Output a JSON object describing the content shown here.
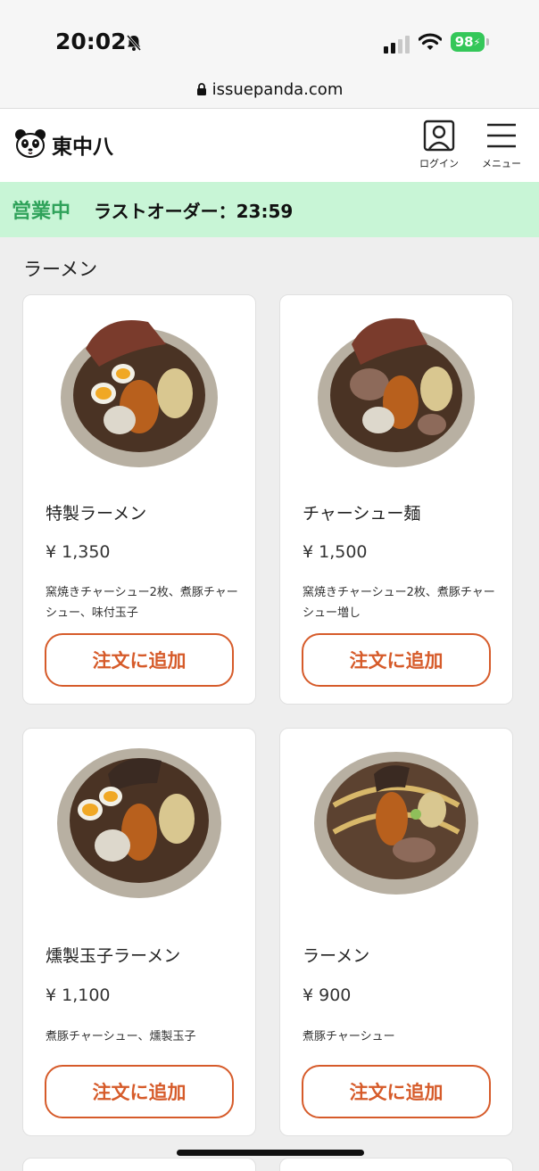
{
  "status_bar": {
    "time": "20:02",
    "battery": "98"
  },
  "browser": {
    "url": "issuepanda.com"
  },
  "header": {
    "logo_text": "東中八",
    "login_label": "ログイン",
    "menu_label": "メニュー"
  },
  "store_status": {
    "open_label": "営業中",
    "last_order": "ラストオーダー：23:59",
    "color": "#2fa25a",
    "background": "#c8f5d6"
  },
  "menu": {
    "section_title": "ラーメン",
    "add_button_label": "注文に追加",
    "accent_color": "#d65b2a",
    "items": [
      {
        "name": "特製ラーメン",
        "price": "¥ 1,350",
        "description": "窯焼きチャーシュー2枚、煮豚チャーシュー、味付玉子"
      },
      {
        "name": "チャーシュー麺",
        "price": "¥ 1,500",
        "description": "窯焼きチャーシュー2枚、煮豚チャーシュー増し"
      },
      {
        "name": "燻製玉子ラーメン",
        "price": "¥ 1,100",
        "description": "煮豚チャーシュー、燻製玉子"
      },
      {
        "name": "ラーメン",
        "price": "¥ 900",
        "description": "煮豚チャーシュー"
      }
    ]
  }
}
